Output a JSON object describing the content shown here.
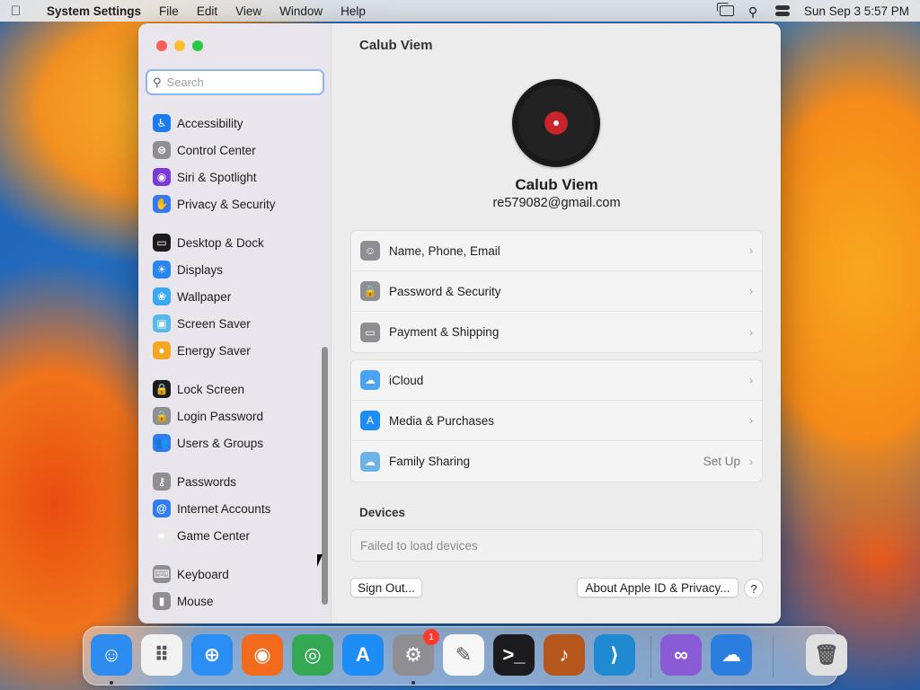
{
  "menubar": {
    "app_name": "System Settings",
    "menus": [
      "File",
      "Edit",
      "View",
      "Window",
      "Help"
    ],
    "clock": "Sun Sep 3  5:57 PM"
  },
  "search": {
    "placeholder": "Search",
    "value": ""
  },
  "sidebar": {
    "items": [
      {
        "label": "Accessibility",
        "icon": "accessibility-icon",
        "color": "#1a7cf0"
      },
      {
        "label": "Control Center",
        "icon": "control-center-icon",
        "color": "#8e8e93"
      },
      {
        "label": "Siri & Spotlight",
        "icon": "siri-icon",
        "color": "#7a3ad8"
      },
      {
        "label": "Privacy & Security",
        "icon": "hand-icon",
        "color": "#3478f6"
      },
      {
        "label": "Desktop & Dock",
        "icon": "dock-icon",
        "color": "#1c1c1e"
      },
      {
        "label": "Displays",
        "icon": "sun-icon",
        "color": "#2a85f0"
      },
      {
        "label": "Wallpaper",
        "icon": "flower-icon",
        "color": "#3ba8f0"
      },
      {
        "label": "Screen Saver",
        "icon": "screen-saver-icon",
        "color": "#5ab8e8"
      },
      {
        "label": "Energy Saver",
        "icon": "bulb-icon",
        "color": "#f5a623"
      },
      {
        "label": "Lock Screen",
        "icon": "lock-icon",
        "color": "#1c1c1e"
      },
      {
        "label": "Login Password",
        "icon": "login-lock-icon",
        "color": "#8e8e93"
      },
      {
        "label": "Users & Groups",
        "icon": "users-icon",
        "color": "#2f7cf0"
      },
      {
        "label": "Passwords",
        "icon": "key-icon",
        "color": "#8e8e93"
      },
      {
        "label": "Internet Accounts",
        "icon": "at-icon",
        "color": "#2f7cf0"
      },
      {
        "label": "Game Center",
        "icon": "game-center-icon",
        "color": "#e8e8e8"
      },
      {
        "label": "Keyboard",
        "icon": "keyboard-icon",
        "color": "#8e8e93"
      },
      {
        "label": "Mouse",
        "icon": "mouse-icon",
        "color": "#8e8e93"
      }
    ]
  },
  "main": {
    "title": "Calub Viem",
    "user_name": "Calub Viem",
    "user_email": "re579082@gmail.com",
    "group1": [
      {
        "label": "Name, Phone, Email",
        "icon": "person-icon",
        "color": "#8e8e93"
      },
      {
        "label": "Password & Security",
        "icon": "padlock-icon",
        "color": "#8e8e93"
      },
      {
        "label": "Payment & Shipping",
        "icon": "card-icon",
        "color": "#8e8e93"
      }
    ],
    "group2": [
      {
        "label": "iCloud",
        "icon": "cloud-icon",
        "color": "#4ba3f5",
        "value": ""
      },
      {
        "label": "Media & Purchases",
        "icon": "app-store-icon",
        "color": "#1e8cf5",
        "value": ""
      },
      {
        "label": "Family Sharing",
        "icon": "family-icon",
        "color": "#6cb4e8",
        "value": "Set Up"
      }
    ],
    "devices_title": "Devices",
    "devices_message": "Failed to load devices",
    "sign_out_label": "Sign Out...",
    "about_label": "About Apple ID & Privacy...",
    "help_label": "?"
  },
  "dock": {
    "apps": [
      {
        "name": "finder-icon",
        "glyph": "☺",
        "color": "#2e8bf0",
        "running": true
      },
      {
        "name": "launchpad-icon",
        "glyph": "⠿",
        "color": "#f2f2f2",
        "running": false
      },
      {
        "name": "safari-icon",
        "glyph": "⊕",
        "color": "#2a8ef5",
        "running": false
      },
      {
        "name": "firefox-icon",
        "glyph": "◉",
        "color": "#f26b1d",
        "running": false
      },
      {
        "name": "chrome-icon",
        "glyph": "◎",
        "color": "#34a853",
        "running": false
      },
      {
        "name": "app-store-icon",
        "glyph": "A",
        "color": "#1e8cf5",
        "running": false
      },
      {
        "name": "system-settings-icon",
        "glyph": "⚙",
        "color": "#8e8e93",
        "running": true,
        "badge": "1"
      },
      {
        "name": "textedit-icon",
        "glyph": "✎",
        "color": "#f6f6f6",
        "running": false
      },
      {
        "name": "terminal-icon",
        "glyph": ">_",
        "color": "#1c1c1e",
        "running": false
      },
      {
        "name": "garageband-icon",
        "glyph": "♪",
        "color": "#b5571c",
        "running": false
      },
      {
        "name": "vscode-icon",
        "glyph": "⟩",
        "color": "#1f8ad2",
        "running": false
      },
      {
        "name": "visual-studio-icon",
        "glyph": "∞",
        "color": "#8a5bd4",
        "running": false
      },
      {
        "name": "weather-icon",
        "glyph": "☁",
        "color": "#2c7de0",
        "running": false
      },
      {
        "name": "trash-icon",
        "glyph": "🗑",
        "color": "#e0e0e0",
        "running": false
      }
    ]
  }
}
